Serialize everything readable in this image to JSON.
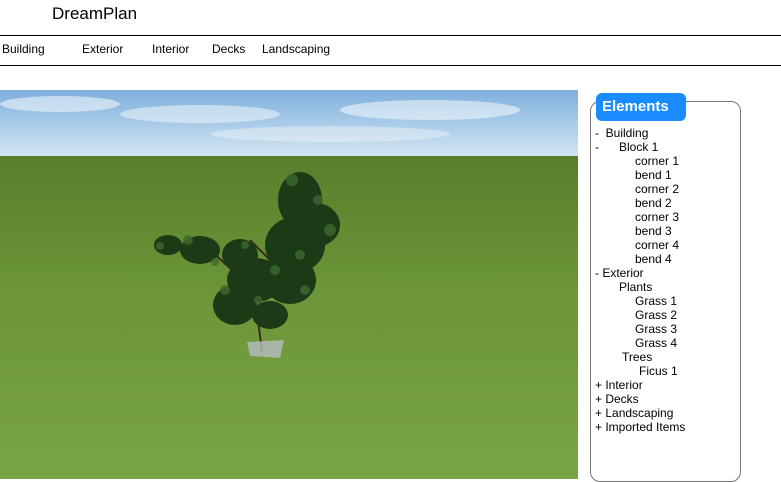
{
  "app": {
    "title": "DreamPlan"
  },
  "menu": [
    {
      "label": "Building"
    },
    {
      "label": "Exterior"
    },
    {
      "label": "Interior"
    },
    {
      "label": "Decks"
    },
    {
      "label": "Landscaping"
    }
  ],
  "panel": {
    "title": "Elements",
    "tree": [
      {
        "text": "-  Building"
      },
      {
        "text": "-      Block 1"
      },
      {
        "text": "corner 1"
      },
      {
        "text": "bend 1"
      },
      {
        "text": "corner 2"
      },
      {
        "text": "bend 2"
      },
      {
        "text": "corner 3"
      },
      {
        "text": "bend 3"
      },
      {
        "text": "corner 4"
      },
      {
        "text": "bend 4"
      },
      {
        "text": "- Exterior"
      },
      {
        "text": "Plants"
      },
      {
        "text": "Grass 1"
      },
      {
        "text": "Grass 2"
      },
      {
        "text": "Grass 3"
      },
      {
        "text": "Grass 4"
      },
      {
        "text": "Trees"
      },
      {
        "text": "Ficus 1"
      },
      {
        "text": "+ Interior"
      },
      {
        "text": "+ Decks"
      },
      {
        "text": "+ Landscaping"
      },
      {
        "text": "+ Imported Items"
      }
    ]
  },
  "colors": {
    "accent": "#1a8cff",
    "grass": "#6f9a3d",
    "sky": "#9cc3e6"
  }
}
